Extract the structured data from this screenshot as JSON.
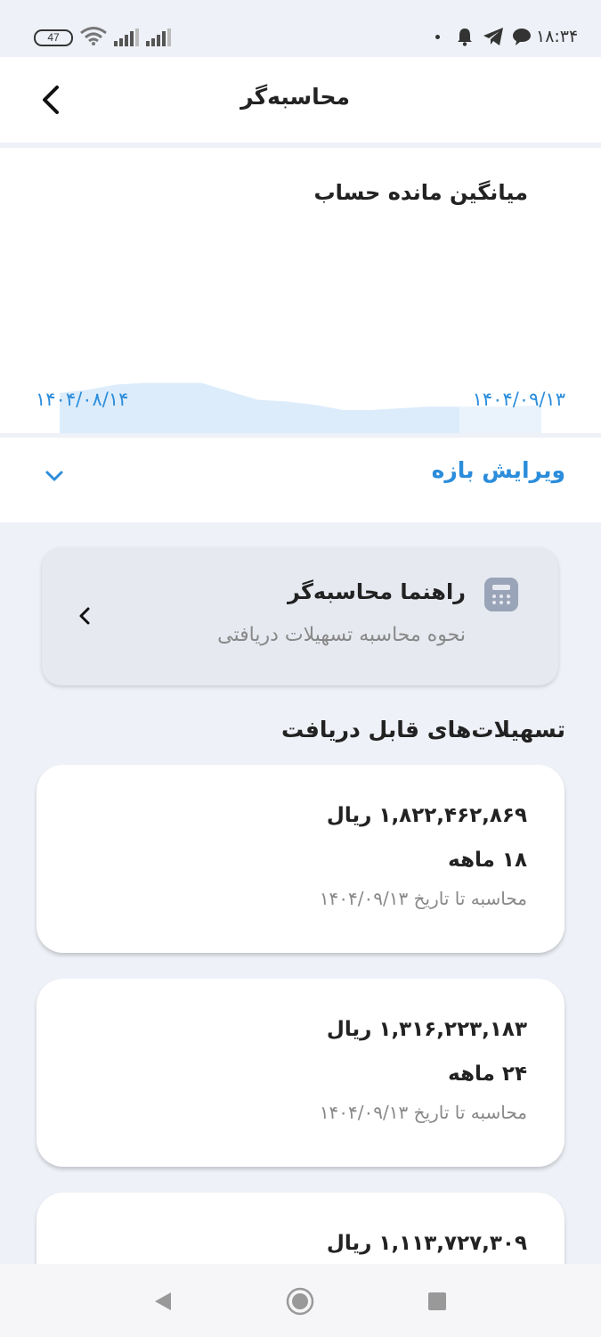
{
  "status_bar": {
    "battery": "47",
    "time": "۱۸:۳۴"
  },
  "header": {
    "title": "محاسبه‌گر"
  },
  "balance_chart": {
    "title": "میانگین مانده حساب",
    "start_date": "۱۴۰۴/۰۸/۱۴",
    "end_date": "۱۴۰۴/۰۹/۱۳"
  },
  "chart_data": {
    "type": "area",
    "x": [
      "۱۴۰۴/۰۸/۱۴",
      "۱۴۰۴/۰۹/۱۳"
    ],
    "values": [
      0.7,
      0.72,
      0.75,
      0.76,
      0.76,
      0.76,
      0.71,
      0.66,
      0.65,
      0.63,
      0.6,
      0.6,
      0.61,
      0.62,
      0.62,
      0.62,
      0.62,
      0.63
    ],
    "selected_fraction": 0.83,
    "colors": {
      "area": "#dcecfb",
      "area_unselected": "#eaf3fc",
      "range_bar": "#1a6fd1"
    }
  },
  "range": {
    "label": "ویرایش بازه"
  },
  "guide": {
    "title": "راهنما محاسبه‌گر",
    "subtitle": "نحوه محاسبه تسهیلات دریافتی"
  },
  "loans_section": {
    "title": "تسهیلات‌های قابل دریافت"
  },
  "loans": [
    {
      "amount": "۱,۸۲۲,۴۶۲,۸۶۹ ریال",
      "term": "۱۸ ماهه",
      "calc_date": "محاسبه تا تاریخ ۱۴۰۴/۰۹/۱۳"
    },
    {
      "amount": "۱,۳۱۶,۲۲۳,۱۸۳ ریال",
      "term": "۲۴ ماهه",
      "calc_date": "محاسبه تا تاریخ ۱۴۰۴/۰۹/۱۳"
    },
    {
      "amount": "۱,۱۱۳,۷۲۷,۳۰۹ ریال"
    }
  ]
}
